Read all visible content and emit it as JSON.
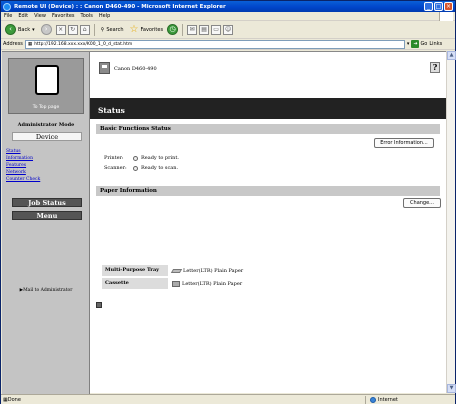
{
  "window": {
    "title": "Remote UI (Device) : : Canon D460-490 - Microsoft Internet Explorer"
  },
  "menu": [
    "File",
    "Edit",
    "View",
    "Favorites",
    "Tools",
    "Help"
  ],
  "toolbar": {
    "back": "Back",
    "search": "Search",
    "favorites": "Favorites"
  },
  "address": {
    "label": "Address",
    "url": "http://192.168.xxx.xxx/K00_1_0_d_stat.htm",
    "go": "Go",
    "links": "Links"
  },
  "sidebar": {
    "top_page": "To Top page",
    "mode": "Administrator Mode",
    "device": "Device",
    "links": [
      "Status",
      "Information",
      "Features",
      "Network",
      "Counter Check"
    ],
    "job_status": "Job Status",
    "menu": "Menu",
    "mail": "Mail to Administrator"
  },
  "main": {
    "device_name": "Canon D460-490",
    "help": "?",
    "title": "Status",
    "basic_title": "Basic Functions Status",
    "error_btn": "Error Information...",
    "printer_label": "Printer:",
    "printer_status": "Ready to print.",
    "scanner_label": "Scanner:",
    "scanner_status": "Ready to scan.",
    "paper_title": "Paper Information",
    "change_btn": "Change...",
    "paper": [
      {
        "source": "Multi-Purpose Tray",
        "paper": "Letter(LTR) Plain Paper"
      },
      {
        "source": "Cassette",
        "paper": "Letter(LTR) Plain Paper"
      }
    ]
  },
  "statusbar": {
    "left": "Done",
    "zone": "Internet"
  }
}
